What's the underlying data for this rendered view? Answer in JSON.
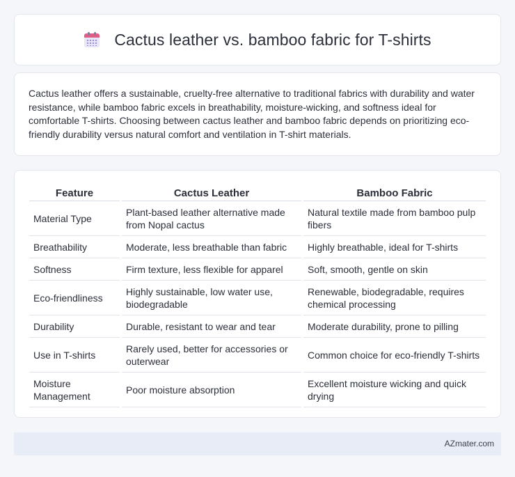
{
  "header": {
    "icon": "calendar-icon",
    "title": "Cactus leather vs. bamboo fabric for T-shirts"
  },
  "intro": {
    "text": "Cactus leather offers a sustainable, cruelty-free alternative to traditional fabrics with durability and water resistance, while bamboo fabric excels in breathability, moisture-wicking, and softness ideal for comfortable T-shirts. Choosing between cactus leather and bamboo fabric depends on prioritizing eco-friendly durability versus natural comfort and ventilation in T-shirt materials."
  },
  "table": {
    "headers": [
      "Feature",
      "Cactus Leather",
      "Bamboo Fabric"
    ],
    "rows": [
      [
        "Material Type",
        "Plant-based leather alternative made from Nopal cactus",
        "Natural textile made from bamboo pulp fibers"
      ],
      [
        "Breathability",
        "Moderate, less breathable than fabric",
        "Highly breathable, ideal for T-shirts"
      ],
      [
        "Softness",
        "Firm texture, less flexible for apparel",
        "Soft, smooth, gentle on skin"
      ],
      [
        "Eco-friendliness",
        "Highly sustainable, low water use, biodegradable",
        "Renewable, biodegradable, requires chemical processing"
      ],
      [
        "Durability",
        "Durable, resistant to wear and tear",
        "Moderate durability, prone to pilling"
      ],
      [
        "Use in T-shirts",
        "Rarely used, better for accessories or outerwear",
        "Common choice for eco-friendly T-shirts"
      ],
      [
        "Moisture Management",
        "Poor moisture absorption",
        "Excellent moisture wicking and quick drying"
      ]
    ]
  },
  "footer": {
    "brand": "AZmater.com"
  }
}
